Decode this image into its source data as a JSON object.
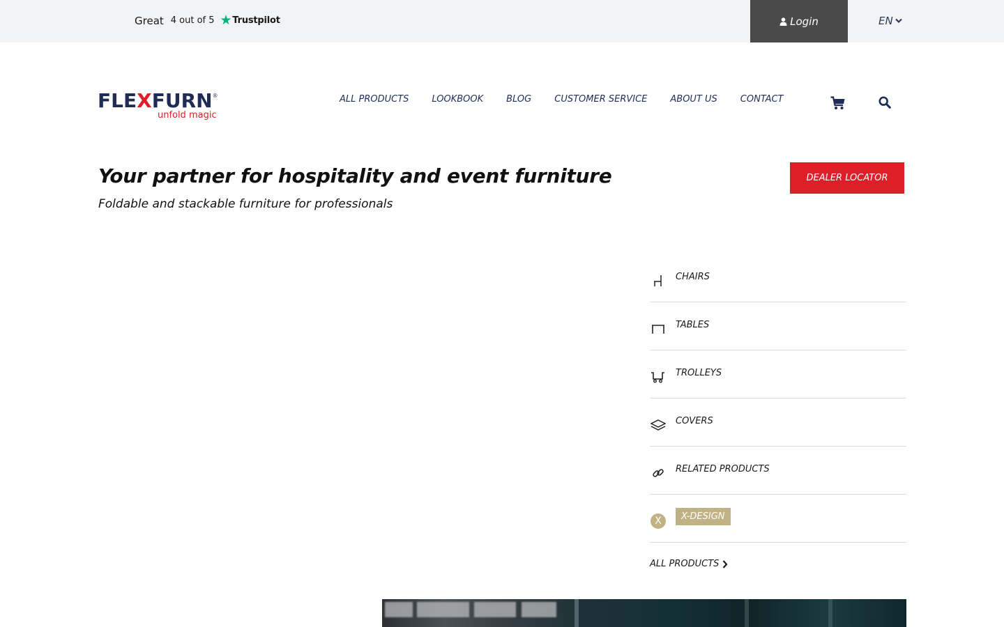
{
  "topbar": {
    "trustpilot": {
      "rating_word": "Great",
      "score_text": "4 out of 5",
      "brand": "Trustpilot",
      "star_color": "#00b67a"
    },
    "login_label": "Login",
    "language": "EN"
  },
  "logo": {
    "wordmark_start": "FLE",
    "wordmark_x": "X",
    "wordmark_end": "FURN",
    "reg_mark": "®",
    "tagline": "unfold magic"
  },
  "nav": {
    "items": [
      {
        "label": "ALL PRODUCTS"
      },
      {
        "label": "LOOKBOOK"
      },
      {
        "label": "BLOG"
      },
      {
        "label": "CUSTOMER SERVICE"
      },
      {
        "label": "ABOUT US"
      },
      {
        "label": "CONTACT"
      }
    ],
    "cart_icon": "cart-icon",
    "search_icon": "search-icon"
  },
  "hero": {
    "title": "Your partner for hospitality and event furniture",
    "subtitle": "Foldable and stackable furniture for professionals",
    "dealer_button": "DEALER LOCATOR"
  },
  "categories": {
    "items": [
      {
        "label": "CHAIRS",
        "icon": "chair-icon"
      },
      {
        "label": "TABLES",
        "icon": "table-icon"
      },
      {
        "label": "TROLLEYS",
        "icon": "trolley-icon"
      },
      {
        "label": "COVERS",
        "icon": "layers-icon"
      },
      {
        "label": "RELATED PRODUCTS",
        "icon": "link-icon"
      },
      {
        "label": "X-DESIGN",
        "icon": "x-design-icon"
      }
    ],
    "all_products_link": "ALL PRODUCTS"
  },
  "colors": {
    "brand_navy": "#1f2d56",
    "brand_red": "#dd1f2a",
    "x_design_gold": "#c1b285",
    "login_bg": "#4a4a4a"
  }
}
